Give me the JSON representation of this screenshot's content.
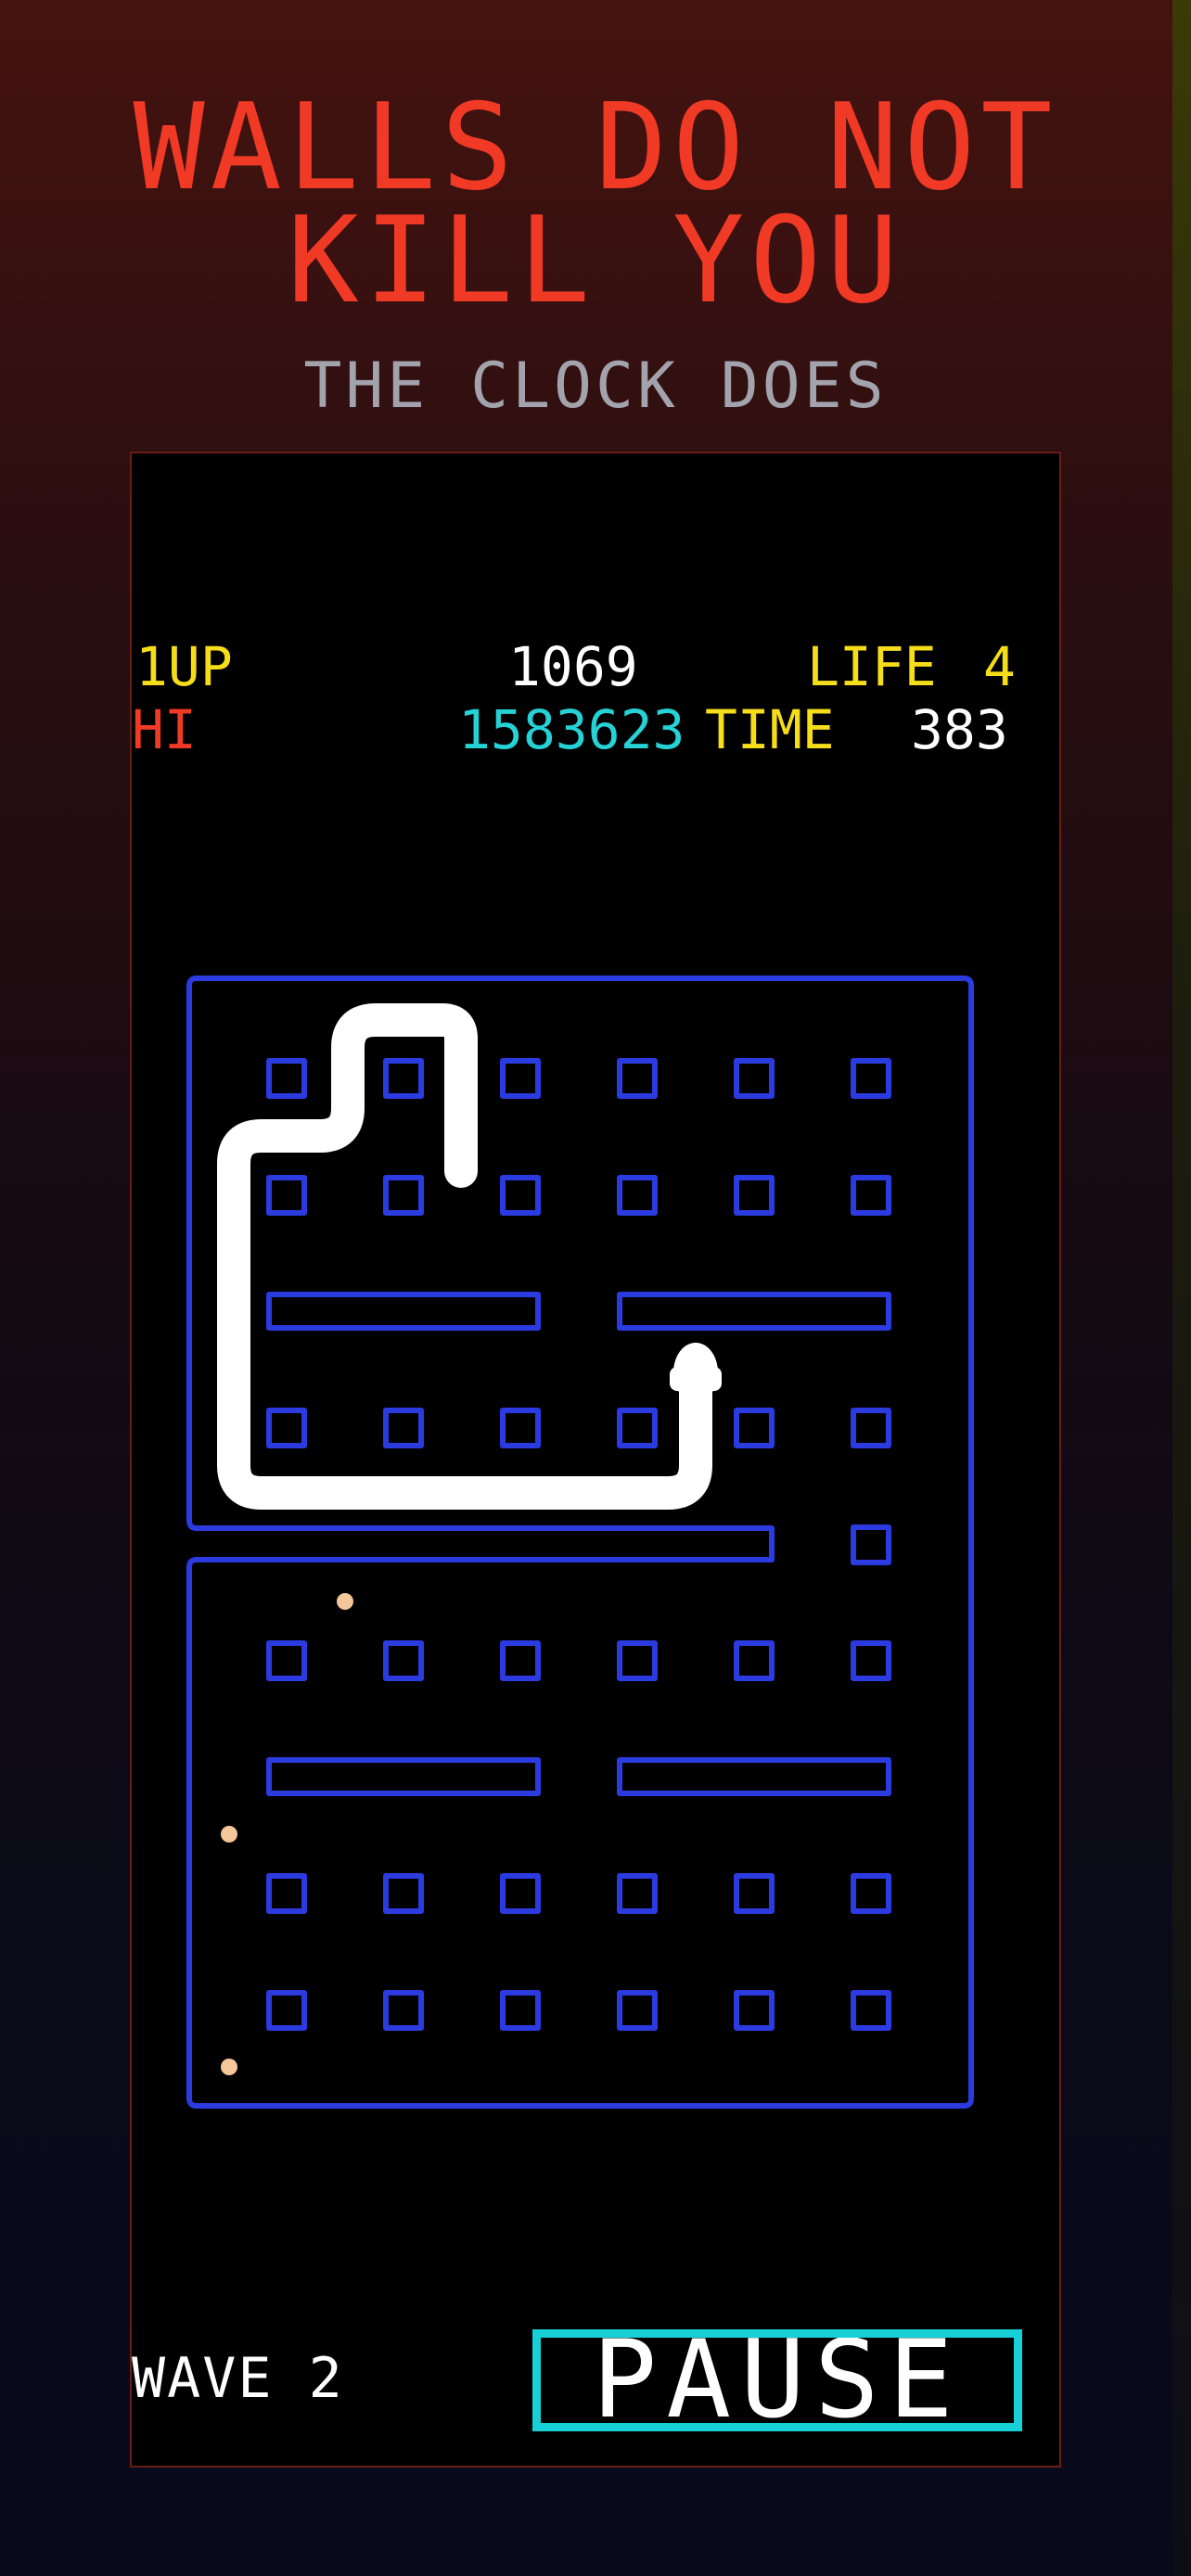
{
  "title": {
    "line1": "WALLS DO NOT",
    "line2": "KILL YOU"
  },
  "subtitle": "THE CLOCK DOES",
  "hud": {
    "player_label": "1UP",
    "score": "1069",
    "lives_label": "LIFE",
    "lives": "4",
    "hi_label": "HI",
    "hi_score": "1583623",
    "time_label": "TIME",
    "time": "383"
  },
  "footer": {
    "wave_label": "WAVE",
    "wave": "2",
    "pause_label": "PAUSE"
  },
  "colors": {
    "headline": "#f03a26",
    "maze_wall": "#2b3be0",
    "snake": "#ffffff",
    "pellet": "#f4c79a",
    "pause_border": "#17d0d6",
    "hud_yellow": "#f5dd1a",
    "hud_cyan": "#25d2d6"
  }
}
